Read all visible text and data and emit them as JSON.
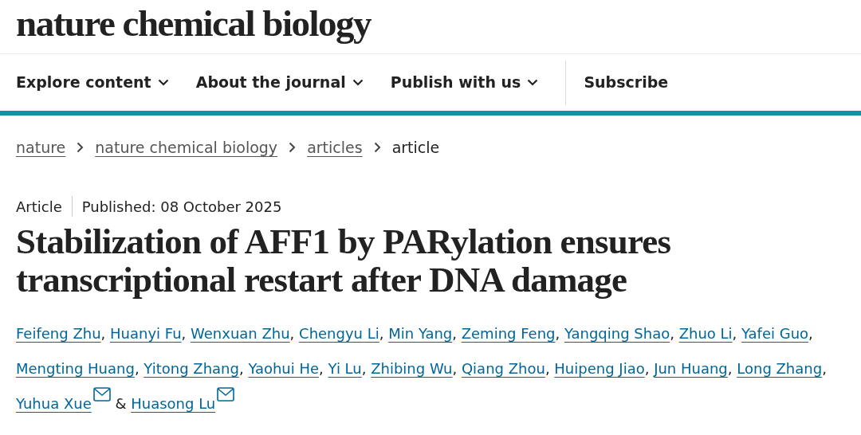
{
  "logo": "nature chemical biology",
  "nav": [
    {
      "label": "Explore content",
      "dropdown": true
    },
    {
      "label": "About the journal",
      "dropdown": true
    },
    {
      "label": "Publish with us",
      "dropdown": true
    },
    {
      "label": "Subscribe",
      "dropdown": false
    }
  ],
  "breadcrumbs": [
    {
      "label": "nature",
      "link": true
    },
    {
      "label": "nature chemical biology",
      "link": true
    },
    {
      "label": "articles",
      "link": true
    },
    {
      "label": "article",
      "link": false
    }
  ],
  "article_type": "Article",
  "published": "Published: 08 October 2025",
  "title": "Stabilization of AFF1 by PARylation ensures transcriptional restart after DNA damage",
  "authors": [
    {
      "name": "Feifeng Zhu",
      "separator": ", ",
      "email": false
    },
    {
      "name": "Huanyi Fu",
      "separator": ", ",
      "email": false
    },
    {
      "name": "Wenxuan Zhu",
      "separator": ", ",
      "email": false
    },
    {
      "name": "Chengyu Li",
      "separator": ", ",
      "email": false
    },
    {
      "name": "Min Yang",
      "separator": ", ",
      "email": false
    },
    {
      "name": "Zeming Feng",
      "separator": ", ",
      "email": false
    },
    {
      "name": "Yangqing Shao",
      "separator": ", ",
      "email": false
    },
    {
      "name": "Zhuo Li",
      "separator": ", ",
      "email": false
    },
    {
      "name": "Yafei Guo",
      "separator": ", ",
      "email": false
    },
    {
      "name": "Mengting Huang",
      "separator": ", ",
      "email": false
    },
    {
      "name": "Yitong Zhang",
      "separator": ", ",
      "email": false
    },
    {
      "name": "Yaohui He",
      "separator": ", ",
      "email": false
    },
    {
      "name": "Yi Lu",
      "separator": ", ",
      "email": false
    },
    {
      "name": "Zhibing Wu",
      "separator": ", ",
      "email": false
    },
    {
      "name": "Qiang Zhou",
      "separator": ", ",
      "email": false
    },
    {
      "name": "Huipeng Jiao",
      "separator": ", ",
      "email": false
    },
    {
      "name": "Jun Huang",
      "separator": ", ",
      "email": false
    },
    {
      "name": "Long Zhang",
      "separator": ", ",
      "email": false
    },
    {
      "name": "Yuhua Xue",
      "separator": " & ",
      "email": true
    },
    {
      "name": "Huasong Lu",
      "email": true
    }
  ]
}
